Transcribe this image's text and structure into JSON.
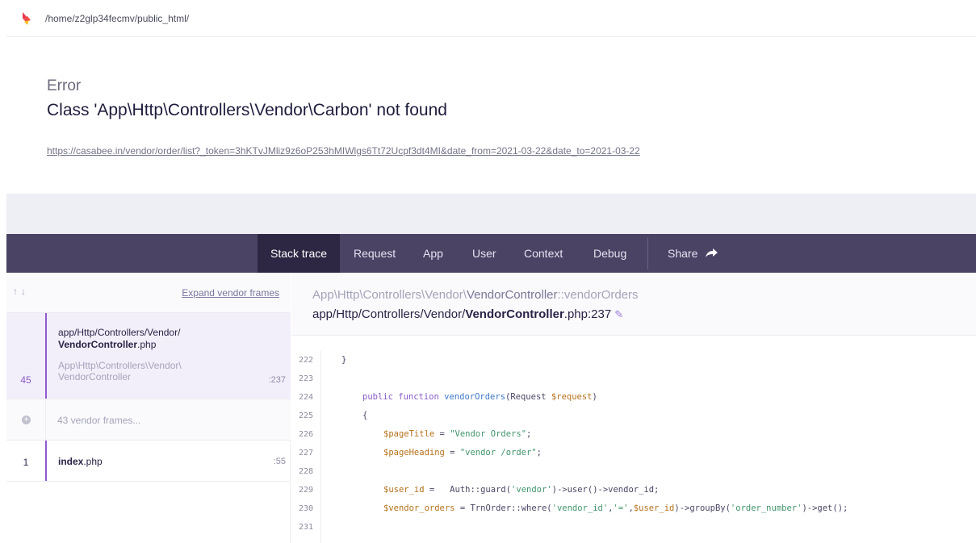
{
  "header": {
    "path": "/home/z2glp34fecmv/public_html/"
  },
  "error": {
    "type": "Error",
    "message": "Class 'App\\Http\\Controllers\\Vendor\\Carbon' not found",
    "url": "https://casabee.in/vendor/order/list?_token=3hKTvJMliz9z6oP253hMIWlgs6Tt72Ucpf3dt4MI&date_from=2021-03-22&date_to=2021-03-22"
  },
  "nav": {
    "tabs": [
      "Stack trace",
      "Request",
      "App",
      "User",
      "Context",
      "Debug"
    ],
    "active": "Stack trace",
    "share_label": "Share"
  },
  "stack": {
    "expand_label": "Expand vendor frames",
    "frames": [
      {
        "number": "45",
        "path_prefix": "app/Http/Controllers/Vendor/",
        "file_name": "VendorController",
        "file_ext": ".php",
        "namespace": "App\\Http\\Controllers\\Vendor\\",
        "class": "VendorController",
        "line": ":237"
      },
      {
        "label": "43 vendor frames..."
      },
      {
        "number": "1",
        "file_name": "index",
        "file_ext": ".php",
        "line": ":55"
      }
    ]
  },
  "detail": {
    "class_prefix": "App\\Http\\Controllers\\Vendor\\",
    "class_name": "VendorController",
    "method": "::vendorOrders",
    "file_prefix": "app/Http/Controllers/Vendor/",
    "file_name": "VendorController",
    "file_suffix": ".php:237"
  },
  "code": {
    "line_numbers": [
      "222",
      "223",
      "224",
      "225",
      "226",
      "227",
      "228",
      "229",
      "230",
      "231"
    ],
    "lines": {
      "l222": "}",
      "l224_kw": "public function ",
      "l224_fn": "vendorOrders",
      "l224_a": "(Request ",
      "l224_var": "$request",
      "l224_b": ")",
      "l225": "{",
      "l226_var": "$pageTitle",
      "l226_a": " = ",
      "l226_str": "\"Vendor Orders\"",
      "l226_b": ";",
      "l227_var": "$pageHeading",
      "l227_a": " = ",
      "l227_str": "\"vendor /order\"",
      "l227_b": ";",
      "l229_var": "$user_id",
      "l229_a": " =   Auth::guard(",
      "l229_str": "'vendor'",
      "l229_b": ")->user()->vendor_id;",
      "l230_var": "$vendor_orders",
      "l230_a": " = TrnOrder::where(",
      "l230_str1": "'vendor_id'",
      "l230_b": ",",
      "l230_str2": "'='",
      "l230_c": ",",
      "l230_var2": "$user_id",
      "l230_d": ")->groupBy(",
      "l230_str3": "'order_number'",
      "l230_e": ")->get();"
    }
  }
}
